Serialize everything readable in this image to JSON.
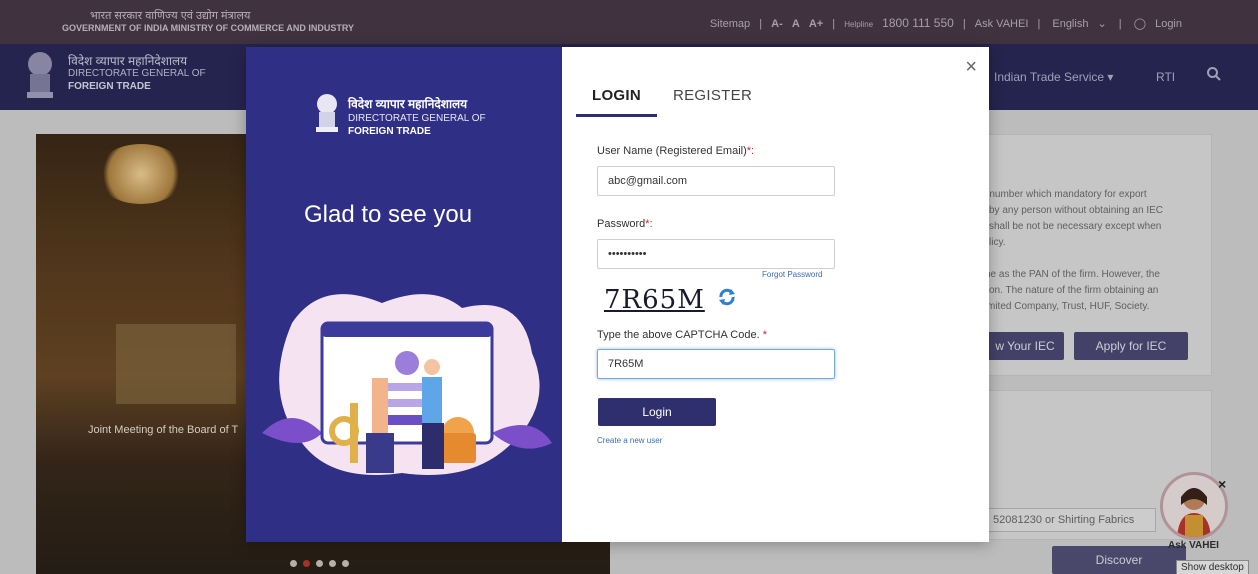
{
  "topbar": {
    "gov_hindi": "भारत सरकार  वाणिज्य एवं उद्योग मंत्रालय",
    "gov_english": "GOVERNMENT OF INDIA  MINISTRY OF COMMERCE AND INDUSTRY",
    "sitemap": "Sitemap",
    "font_small": "A-",
    "font_normal": "A",
    "font_large": "A+",
    "helpline_label": "Helpline",
    "helpline_number": "1800 111 550",
    "ask_vahei": "Ask VAHEI",
    "language": "English",
    "login": "Login",
    "separator": "|"
  },
  "navbar": {
    "dir_hindi": "विदेश व्यापार महानिदेशालय",
    "dir_english_1": "DIRECTORATE GENERAL OF",
    "dir_english_2": "FOREIGN TRADE",
    "menu_trade_service": "Indian Trade Service",
    "menu_rti": "RTI"
  },
  "background": {
    "photo_caption": "Joint Meeting of the Board of T",
    "info_lines": [
      "n number which mandatory for export",
      "by any person without obtaining an IEC",
      "shall be not be necessary except when",
      "licy.",
      "",
      "ne as the PAN of the firm. However, the",
      "on. The nature of the firm obtaining an",
      "mited Company, Trust, HUF, Society."
    ],
    "know_iec_btn": "w Your IEC",
    "apply_iec_btn": "Apply for IEC",
    "search_hint": "52081230 or Shirting Fabrics",
    "discover_btn": "Discover",
    "vahei_label": "Ask VAHEI",
    "vahei_close": "×",
    "show_desktop": "Show desktop"
  },
  "modal": {
    "brand_hindi": "विदेश व्यापार महानिदेशालय",
    "brand_english_1": "DIRECTORATE GENERAL OF",
    "brand_english_2": "FOREIGN TRADE",
    "greeting": "Glad to see you",
    "close": "×",
    "tabs": [
      {
        "label": "LOGIN",
        "active": true
      },
      {
        "label": "REGISTER",
        "active": false
      }
    ],
    "username_label": "User Name (Registered Email)",
    "username_value": "abc@gmail.com",
    "password_label": "Password",
    "password_value": "••••••••••",
    "required_mark": "*:",
    "forgot_password": "Forgot Password",
    "captcha_text": "7R65M",
    "captcha_label": "Type the above CAPTCHA Code.",
    "captcha_required": "*",
    "captcha_value": "7R65M",
    "login_button": "Login",
    "create_user": "Create a new user"
  },
  "colors": {
    "modal_left_bg": "#302f86",
    "login_button": "#302f6e",
    "nav_bg": "#2b2a5a",
    "topbar_bg": "#4a3a48",
    "link": "#3b6cb4",
    "required": "#c62828"
  }
}
